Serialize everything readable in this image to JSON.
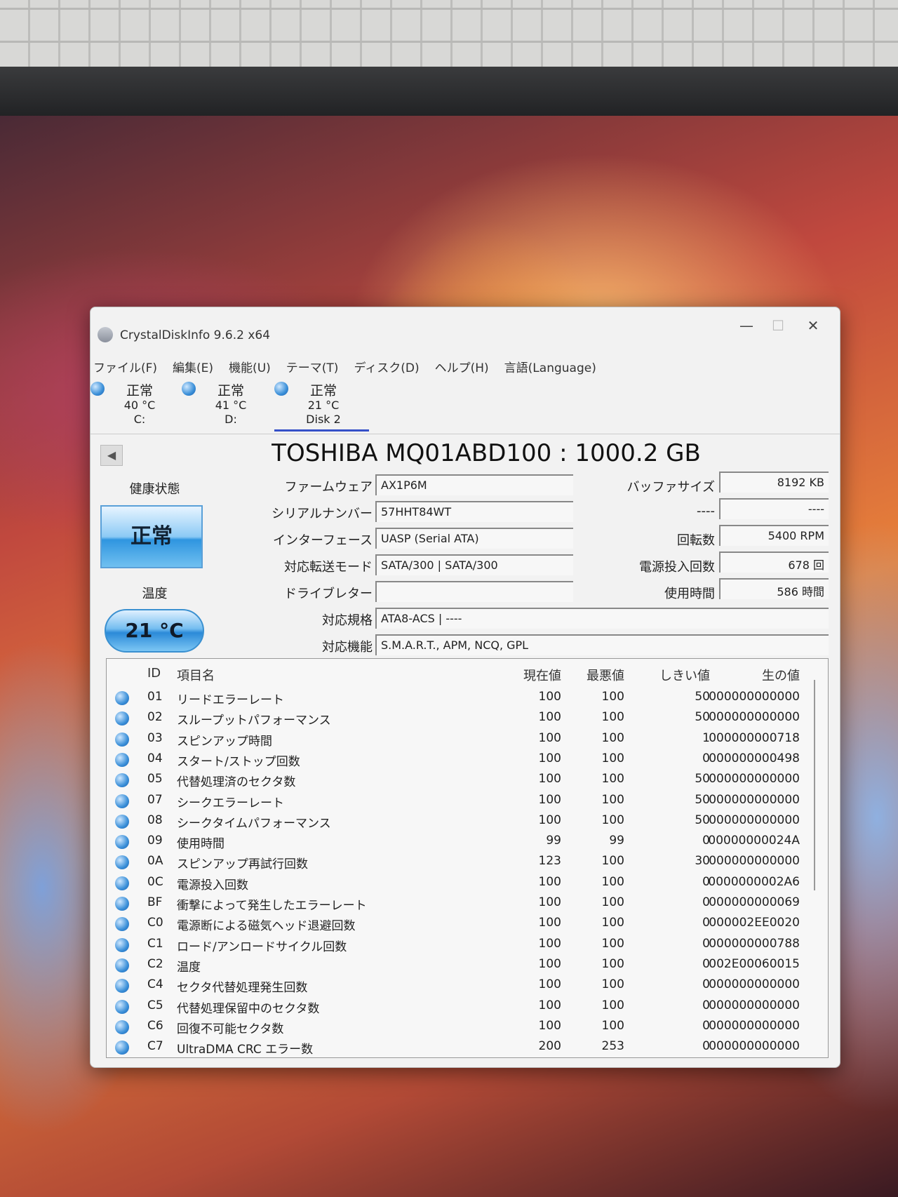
{
  "window": {
    "title": "CrystalDiskInfo 9.6.2 x64",
    "minimize": "—",
    "maximize": "☐",
    "close": "✕"
  },
  "menu": [
    "ファイル(F)",
    "編集(E)",
    "機能(U)",
    "テーマ(T)",
    "ディスク(D)",
    "ヘルプ(H)",
    "言語(Language)"
  ],
  "disks": [
    {
      "status": "正常",
      "temp": "40 °C",
      "name": "C:"
    },
    {
      "status": "正常",
      "temp": "41 °C",
      "name": "D:"
    },
    {
      "status": "正常",
      "temp": "21 °C",
      "name": "Disk 2"
    }
  ],
  "model": "TOSHIBA MQ01ABD100 : 1000.2 GB",
  "prev_button": "◀",
  "health": {
    "label": "健康状態",
    "value": "正常"
  },
  "temperature": {
    "label": "温度",
    "value": "21 °C"
  },
  "info": {
    "firmware": {
      "label": "ファームウェア",
      "value": "AX1P6M"
    },
    "serial": {
      "label": "シリアルナンバー",
      "value": "57HHT84WT"
    },
    "interface": {
      "label": "インターフェース",
      "value": "UASP (Serial ATA)"
    },
    "transfer": {
      "label": "対応転送モード",
      "value": "SATA/300 | SATA/300"
    },
    "drive_letter": {
      "label": "ドライブレター",
      "value": ""
    },
    "standard": {
      "label": "対応規格",
      "value": "ATA8-ACS | ----"
    },
    "features": {
      "label": "対応機能",
      "value": "S.M.A.R.T., APM, NCQ, GPL"
    },
    "buffer": {
      "label": "バッファサイズ",
      "value": "8192 KB"
    },
    "unknown": {
      "label": "----",
      "value": "----"
    },
    "rpm": {
      "label": "回転数",
      "value": "5400 RPM"
    },
    "power_on_count": {
      "label": "電源投入回数",
      "value": "678 回"
    },
    "power_on_hours": {
      "label": "使用時間",
      "value": "586 時間"
    }
  },
  "smart": {
    "headers": {
      "id": "ID",
      "name": "項目名",
      "current": "現在値",
      "worst": "最悪値",
      "threshold": "しきい値",
      "raw": "生の値"
    },
    "rows": [
      {
        "id": "01",
        "name": "リードエラーレート",
        "current": "100",
        "worst": "100",
        "threshold": "50",
        "raw": "000000000000"
      },
      {
        "id": "02",
        "name": "スループットパフォーマンス",
        "current": "100",
        "worst": "100",
        "threshold": "50",
        "raw": "000000000000"
      },
      {
        "id": "03",
        "name": "スピンアップ時間",
        "current": "100",
        "worst": "100",
        "threshold": "1",
        "raw": "000000000718"
      },
      {
        "id": "04",
        "name": "スタート/ストップ回数",
        "current": "100",
        "worst": "100",
        "threshold": "0",
        "raw": "000000000498"
      },
      {
        "id": "05",
        "name": "代替処理済のセクタ数",
        "current": "100",
        "worst": "100",
        "threshold": "50",
        "raw": "000000000000"
      },
      {
        "id": "07",
        "name": "シークエラーレート",
        "current": "100",
        "worst": "100",
        "threshold": "50",
        "raw": "000000000000"
      },
      {
        "id": "08",
        "name": "シークタイムパフォーマンス",
        "current": "100",
        "worst": "100",
        "threshold": "50",
        "raw": "000000000000"
      },
      {
        "id": "09",
        "name": "使用時間",
        "current": "99",
        "worst": "99",
        "threshold": "0",
        "raw": "00000000024A"
      },
      {
        "id": "0A",
        "name": "スピンアップ再試行回数",
        "current": "123",
        "worst": "100",
        "threshold": "30",
        "raw": "000000000000"
      },
      {
        "id": "0C",
        "name": "電源投入回数",
        "current": "100",
        "worst": "100",
        "threshold": "0",
        "raw": "0000000002A6"
      },
      {
        "id": "BF",
        "name": "衝撃によって発生したエラーレート",
        "current": "100",
        "worst": "100",
        "threshold": "0",
        "raw": "000000000069"
      },
      {
        "id": "C0",
        "name": "電源断による磁気ヘッド退避回数",
        "current": "100",
        "worst": "100",
        "threshold": "0",
        "raw": "000002EE0020"
      },
      {
        "id": "C1",
        "name": "ロード/アンロードサイクル回数",
        "current": "100",
        "worst": "100",
        "threshold": "0",
        "raw": "000000000788"
      },
      {
        "id": "C2",
        "name": "温度",
        "current": "100",
        "worst": "100",
        "threshold": "0",
        "raw": "002E00060015"
      },
      {
        "id": "C4",
        "name": "セクタ代替処理発生回数",
        "current": "100",
        "worst": "100",
        "threshold": "0",
        "raw": "000000000000"
      },
      {
        "id": "C5",
        "name": "代替処理保留中のセクタ数",
        "current": "100",
        "worst": "100",
        "threshold": "0",
        "raw": "000000000000"
      },
      {
        "id": "C6",
        "name": "回復不可能セクタ数",
        "current": "100",
        "worst": "100",
        "threshold": "0",
        "raw": "000000000000"
      },
      {
        "id": "C7",
        "name": "UltraDMA CRC エラー数",
        "current": "200",
        "worst": "253",
        "threshold": "0",
        "raw": "000000000000"
      }
    ]
  }
}
